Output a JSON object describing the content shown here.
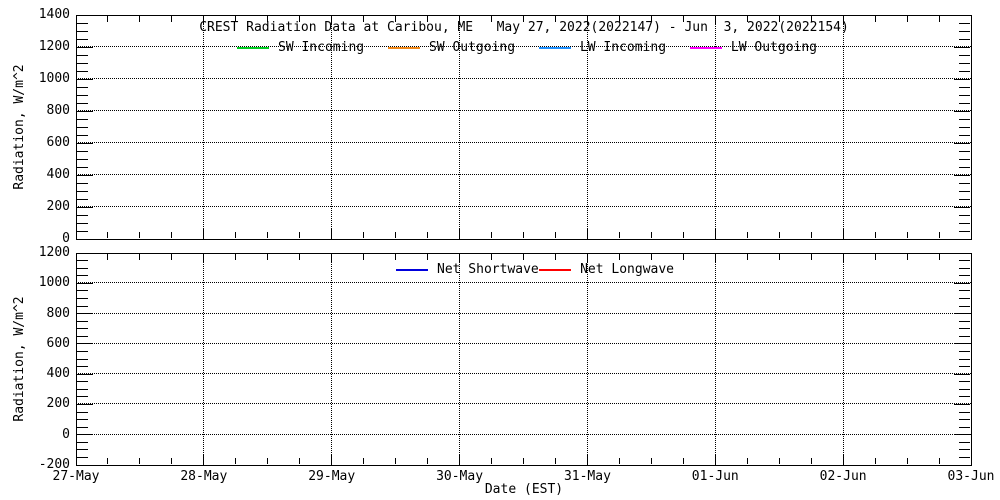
{
  "top_panel": {
    "title": "CREST Radiation Data at Caribou, ME   May 27, 2022(2022147) - Jun  3, 2022(2022154)",
    "ylabel": "Radiation, W/m^2",
    "ytick_labels": [
      "1400",
      "1200",
      "1000",
      "800",
      "600",
      "400",
      "200",
      "0"
    ],
    "legend": [
      {
        "label": "SW Incoming",
        "color": "#00cc22"
      },
      {
        "label": "SW Outgoing",
        "color": "#f08818"
      },
      {
        "label": "LW Incoming",
        "color": "#1e90ff"
      },
      {
        "label": "LW Outgoing",
        "color": "#ff00ff"
      }
    ]
  },
  "bottom_panel": {
    "ylabel": "Radiation, W/m^2",
    "ytick_labels": [
      "1200",
      "1000",
      "800",
      "600",
      "400",
      "200",
      "0",
      "-200"
    ],
    "legend": [
      {
        "label": "Net Shortwave",
        "color": "#0000dd"
      },
      {
        "label": "Net Longwave",
        "color": "#ff0000"
      }
    ]
  },
  "xaxis": {
    "tick_labels": [
      "27-May",
      "28-May",
      "29-May",
      "30-May",
      "31-May",
      "01-Jun",
      "02-Jun",
      "03-Jun"
    ],
    "label": "Date (EST)"
  },
  "chart_data": [
    {
      "type": "line",
      "title": "CREST Radiation Data at Caribou, ME   May 27, 2022(2022147) - Jun  3, 2022(2022154)",
      "xlabel": "Date (EST)",
      "ylabel": "Radiation, W/m^2",
      "ylim": [
        0,
        1400
      ],
      "y_major_ticks": [
        0,
        200,
        400,
        600,
        800,
        1000,
        1200,
        1400
      ],
      "y_minor_step": 50,
      "x_ticks": [
        "27-May",
        "28-May",
        "29-May",
        "30-May",
        "31-May",
        "01-Jun",
        "02-Jun",
        "03-Jun"
      ],
      "x_minor_per_day": 4,
      "grid": true,
      "legend_position": "top-inside",
      "series": [
        {
          "name": "SW Incoming",
          "color": "#00cc22",
          "values": []
        },
        {
          "name": "SW Outgoing",
          "color": "#f08818",
          "values": []
        },
        {
          "name": "LW Incoming",
          "color": "#1e90ff",
          "values": []
        },
        {
          "name": "LW Outgoing",
          "color": "#ff00ff",
          "values": []
        }
      ]
    },
    {
      "type": "line",
      "xlabel": "Date (EST)",
      "ylabel": "Radiation, W/m^2",
      "ylim": [
        -200,
        1200
      ],
      "y_major_ticks": [
        -200,
        0,
        200,
        400,
        600,
        800,
        1000,
        1200
      ],
      "y_minor_step": 50,
      "x_ticks": [
        "27-May",
        "28-May",
        "29-May",
        "30-May",
        "31-May",
        "01-Jun",
        "02-Jun",
        "03-Jun"
      ],
      "x_minor_per_day": 4,
      "grid": true,
      "legend_position": "top-inside",
      "series": [
        {
          "name": "Net Shortwave",
          "color": "#0000dd",
          "values": []
        },
        {
          "name": "Net Longwave",
          "color": "#ff0000",
          "values": []
        }
      ]
    }
  ]
}
